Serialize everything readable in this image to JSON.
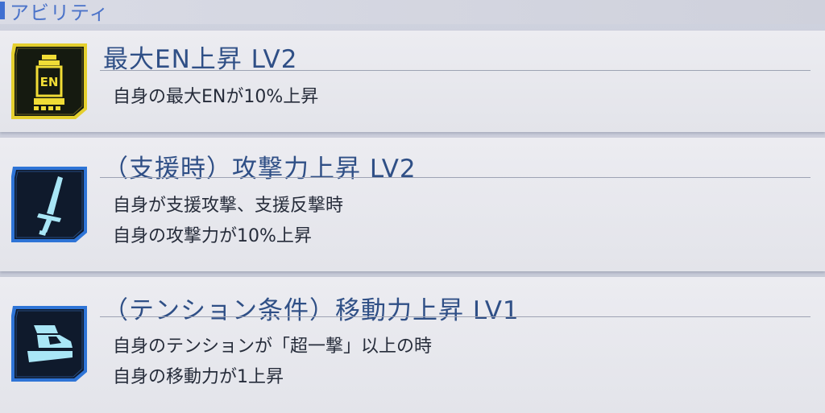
{
  "header": {
    "title": "アビリティ"
  },
  "abilities": [
    {
      "icon": "en-canister-icon",
      "icon_label": "EN",
      "accent": "#e5d23a",
      "title": "最大EN上昇 LV2",
      "lines": [
        "自身の最大ENが10%上昇"
      ]
    },
    {
      "icon": "sword-icon",
      "accent": "#2f7fe0",
      "title": "（支援時）攻撃力上昇 LV2",
      "lines": [
        "自身が支援攻撃、支援反撃時",
        "自身の攻撃力が10%上昇"
      ]
    },
    {
      "icon": "boot-icon",
      "accent": "#2f7fe0",
      "title": "（テンション条件）移動力上昇 LV1",
      "lines": [
        "自身のテンションが「超一撃」以上の時",
        "自身の移動力が1上昇"
      ]
    }
  ]
}
